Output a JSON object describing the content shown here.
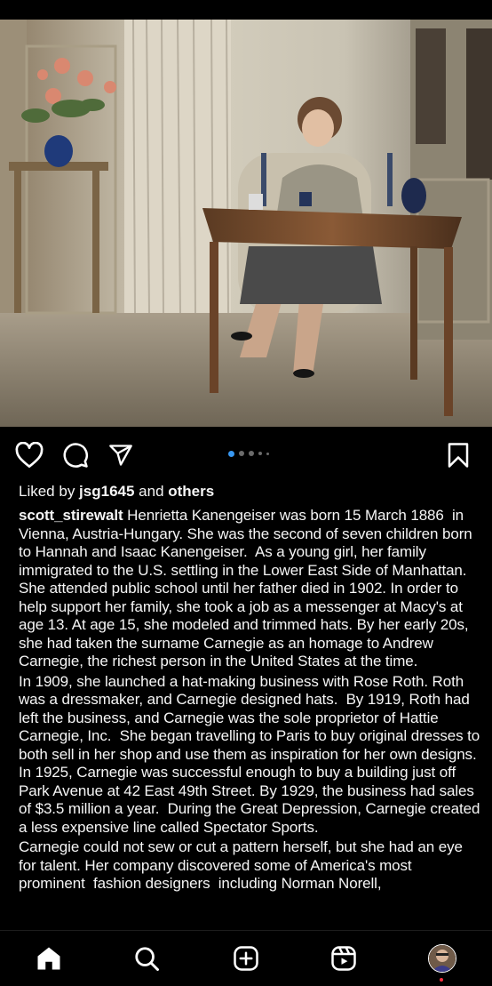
{
  "post": {
    "liked_by_prefix": "Liked by ",
    "liked_by_user": "jsg1645",
    "liked_by_middle": " and ",
    "liked_by_others": "others",
    "author": "scott_stirewalt",
    "caption_paragraphs": [
      " Henrietta Kanengeiser was born 15 March 1886  in Vienna, Austria-Hungary. She was the second of seven children born to Hannah and Isaac Kanengeiser.  As a young girl, her family immigrated to the U.S. settling in the Lower East Side of Manhattan. She attended public school until her father died in 1902. In order to help support her family, she took a job as a messenger at Macy's at age 13. At age 15, she modeled and trimmed hats. By her early 20s, she had taken the surname Carnegie as an homage to Andrew Carnegie, the richest person in the United States at the time.",
      "In 1909, she launched a hat-making business with Rose Roth. Roth was a dressmaker, and Carnegie designed hats.  By 1919, Roth had left the business, and Carnegie was the sole proprietor of Hattie Carnegie, Inc.  She began travelling to Paris to buy original dresses to both sell in her shop and use them as inspiration for her own designs. In 1925, Carnegie was successful enough to buy a building just off Park Avenue at 42 East 49th Street. By 1929, the business had sales of $3.5 million a year.  During the Great Depression, Carnegie created a less expensive line called Spectator Sports.",
      "Carnegie could not sew or cut a pattern herself, but she had an eye for talent. Her company discovered some of America's most prominent  fashion designers  including Norman Norell,"
    ]
  },
  "carousel": {
    "count": 5,
    "active_index": 0
  },
  "actions": [
    "heart-icon",
    "comment-icon",
    "share-icon",
    "bookmark-icon"
  ],
  "nav": [
    "home-icon",
    "search-icon",
    "create-icon",
    "reels-icon",
    "profile-avatar"
  ],
  "colors": {
    "accent": "#3897f0",
    "background": "#000000",
    "notification": "#ff3040"
  }
}
